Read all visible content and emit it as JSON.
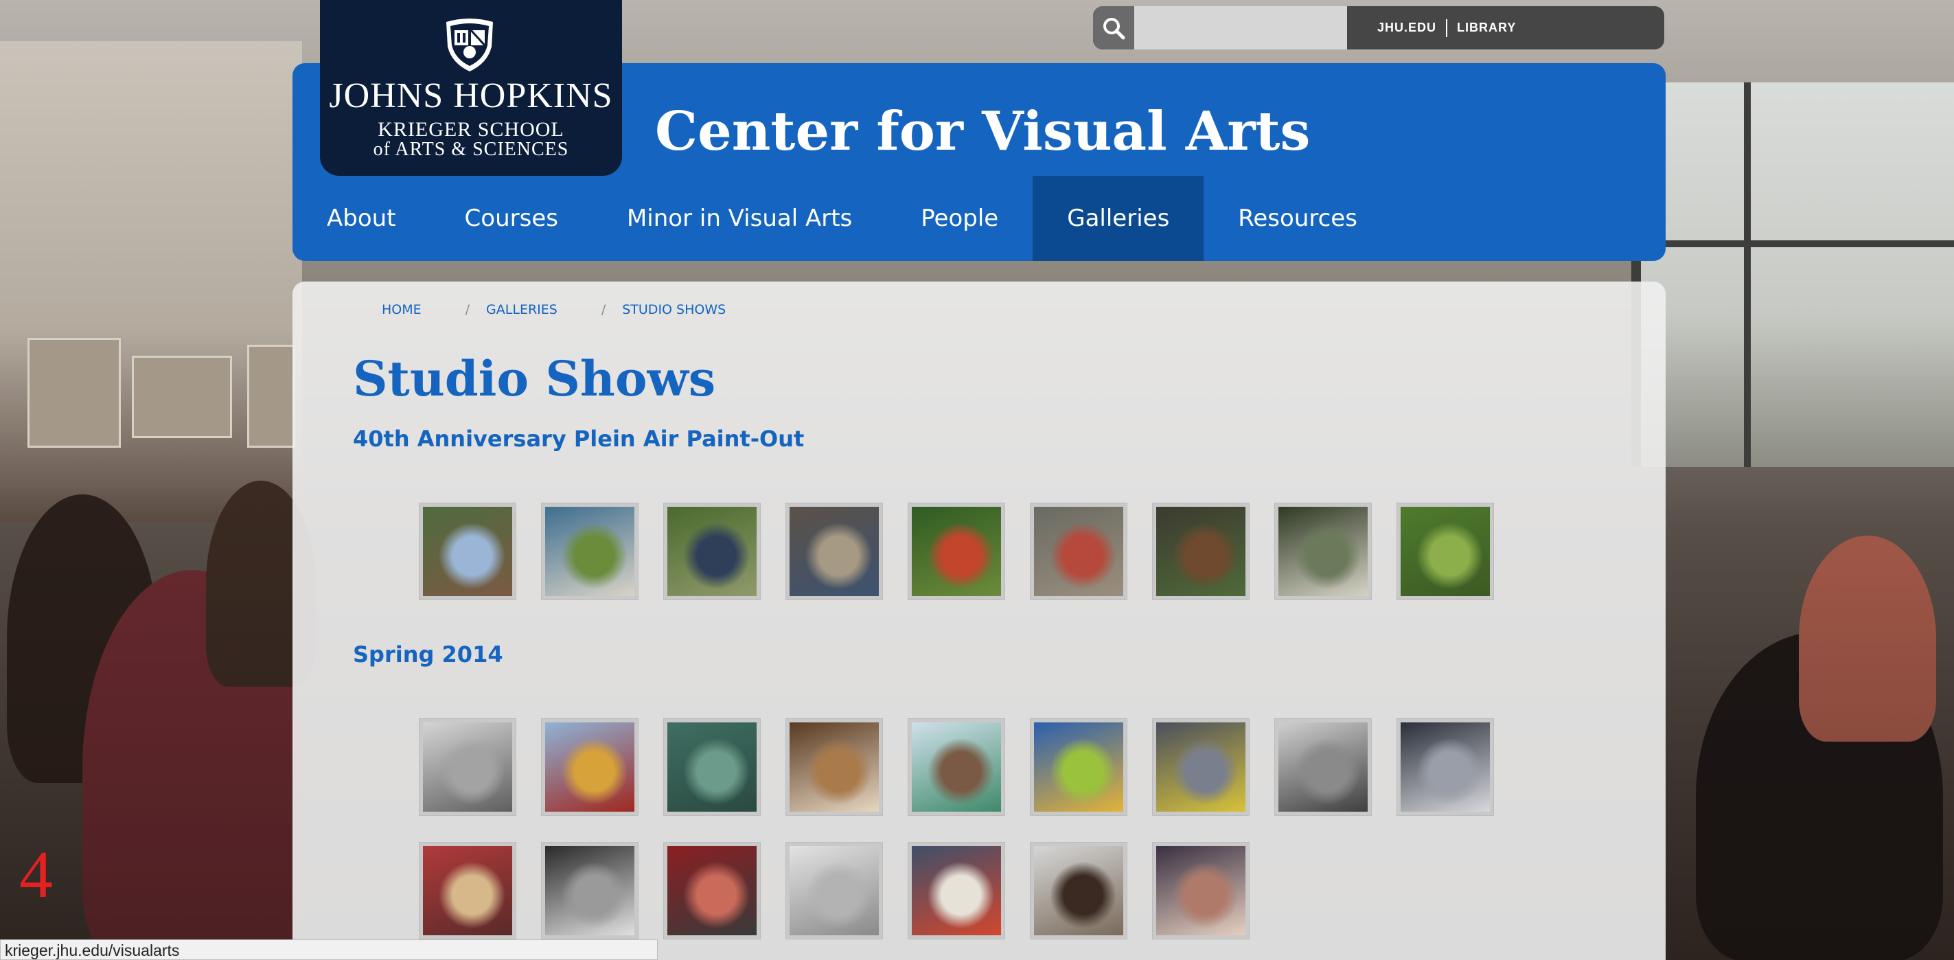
{
  "utility": {
    "search_placeholder": "",
    "links": [
      "JHU.EDU",
      "LIBRARY"
    ]
  },
  "logo": {
    "name": "JOHNS HOPKINS",
    "line1": "KRIEGER SCHOOL",
    "line2": "of ARTS & SCIENCES"
  },
  "site_title": "Center for Visual Arts",
  "nav": {
    "items": [
      "About",
      "Courses",
      "Minor in Visual Arts",
      "People",
      "Galleries",
      "Resources"
    ],
    "active": "Galleries"
  },
  "breadcrumb": [
    "HOME",
    "GALLERIES",
    "STUDIO SHOWS"
  ],
  "page_title": "Studio Shows",
  "sections": [
    {
      "title": "40th Anniversary Plein Air Paint-Out",
      "rows": [
        [
          {
            "name": "plein-air-1",
            "colors": [
              "#4f6b3e",
              "#9ab5d6",
              "#7a5a44"
            ]
          },
          {
            "name": "plein-air-2",
            "colors": [
              "#3e6e8f",
              "#6b8c3a",
              "#d8d3c7"
            ]
          },
          {
            "name": "plein-air-3",
            "colors": [
              "#4a6a2e",
              "#2f3f5a",
              "#8f9a6b"
            ]
          },
          {
            "name": "plein-air-4",
            "colors": [
              "#5b5148",
              "#a79a84",
              "#3d5370"
            ]
          },
          {
            "name": "plein-air-5",
            "colors": [
              "#2f5b23",
              "#c2452c",
              "#6d8b3a"
            ]
          },
          {
            "name": "plein-air-6",
            "colors": [
              "#6a6a62",
              "#b6493b",
              "#9a8f7e"
            ]
          },
          {
            "name": "plein-air-7",
            "colors": [
              "#3c3a2f",
              "#6f4a2e",
              "#4f6a3a"
            ]
          },
          {
            "name": "plein-air-8",
            "colors": [
              "#2f3a24",
              "#6b7a5a",
              "#d5d2c5"
            ]
          },
          {
            "name": "plein-air-9",
            "colors": [
              "#4f7b2c",
              "#8cae4b",
              "#3b5a24"
            ]
          }
        ]
      ]
    },
    {
      "title": "Spring 2014",
      "rows": [
        [
          {
            "name": "spring-1",
            "colors": [
              "#d4d4d4",
              "#a3a3a3",
              "#5f5f5f"
            ]
          },
          {
            "name": "spring-2",
            "colors": [
              "#8fb2d6",
              "#d8a23a",
              "#a02820"
            ]
          },
          {
            "name": "spring-3",
            "colors": [
              "#3f6e62",
              "#6b9b8a",
              "#2a4a42"
            ]
          },
          {
            "name": "spring-4",
            "colors": [
              "#5a3a22",
              "#a97a4a",
              "#e6d6c0"
            ]
          },
          {
            "name": "spring-5",
            "colors": [
              "#cfe0ea",
              "#7a5a44",
              "#3f8a6a"
            ]
          },
          {
            "name": "spring-6",
            "colors": [
              "#2b5fb0",
              "#9bc23c",
              "#e2b33a"
            ]
          },
          {
            "name": "spring-7",
            "colors": [
              "#4a4f5e",
              "#7a7f8e",
              "#d6c23a"
            ]
          },
          {
            "name": "spring-8",
            "colors": [
              "#cfcfcf",
              "#8a8a8a",
              "#3f3f3f"
            ]
          },
          {
            "name": "spring-9",
            "colors": [
              "#2a2f3a",
              "#9a9ea8",
              "#d6d8dc"
            ]
          }
        ],
        [
          {
            "name": "spring-10",
            "colors": [
              "#b03a3a",
              "#d6b88a",
              "#5a2a2a"
            ]
          },
          {
            "name": "spring-11",
            "colors": [
              "#2a2a2a",
              "#9a9a9a",
              "#e0e0e0"
            ]
          },
          {
            "name": "spring-12",
            "colors": [
              "#8a1f23",
              "#c96a5a",
              "#3a3a3a"
            ]
          },
          {
            "name": "spring-13",
            "colors": [
              "#e2e2e2",
              "#b3b3b3",
              "#8a8a8a"
            ]
          },
          {
            "name": "spring-14",
            "colors": [
              "#3f4f6a",
              "#e6e2d8",
              "#d2472e"
            ]
          },
          {
            "name": "spring-15",
            "colors": [
              "#d6d6d6",
              "#3a2a22",
              "#7a6a5a"
            ]
          },
          {
            "name": "spring-16",
            "colors": [
              "#3a3042",
              "#b07a6a",
              "#e6cfc0"
            ]
          }
        ]
      ]
    }
  ],
  "statusbar": "krieger.jhu.edu/visualarts",
  "page_number": "4",
  "colors": {
    "brand_blue": "#1564c0",
    "nav_active": "#0b4a91",
    "logo_navy": "#0b1d38"
  }
}
